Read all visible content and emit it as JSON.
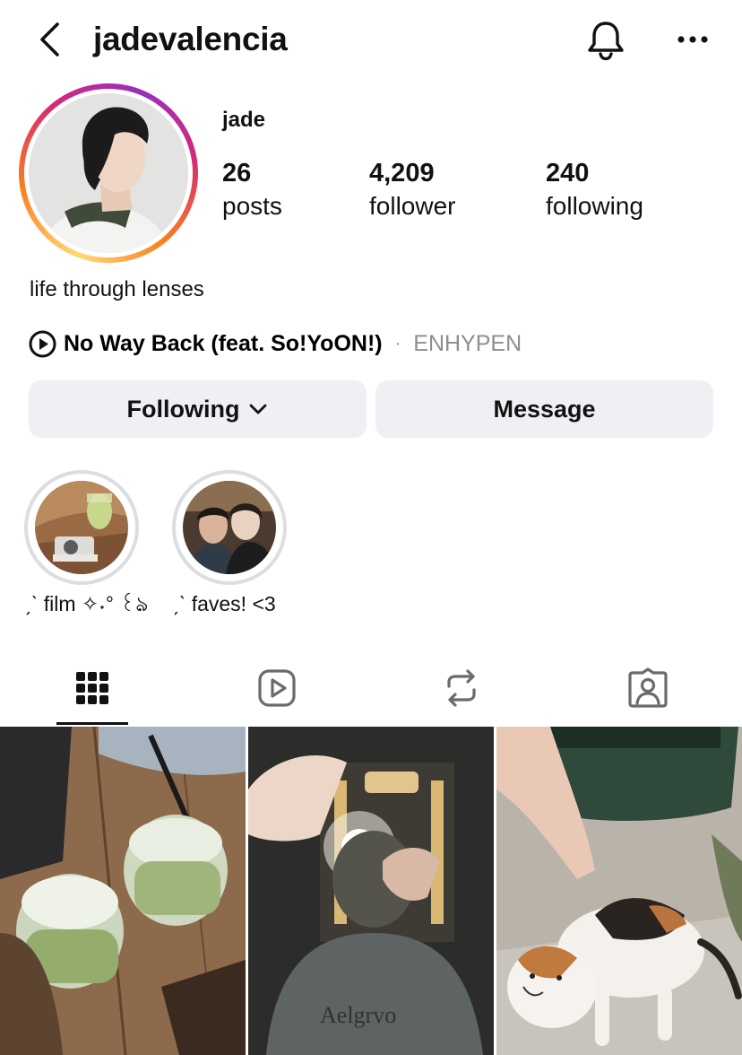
{
  "header": {
    "username": "jadevalencia",
    "back_icon": "chevron-left-icon",
    "bell_icon": "bell-icon",
    "more_icon": "more-horizontal-icon"
  },
  "profile": {
    "display_name": "jade",
    "stats": [
      {
        "value": "26",
        "label": "posts"
      },
      {
        "value": "4,209",
        "label": "follower"
      },
      {
        "value": "240",
        "label": "following"
      }
    ],
    "bio": "life through lenses",
    "music": {
      "icon": "play-circle-icon",
      "title": "No Way Back (feat. So!YoON!)",
      "separator": "·",
      "artist": "ENHYPEN"
    }
  },
  "actions": {
    "following_label": "Following",
    "message_label": "Message"
  },
  "highlights": [
    {
      "label": "ˏˋ film ✧˖° ꒰ঌ"
    },
    {
      "label": "ˏˋ faves! <3"
    }
  ],
  "tabs": [
    {
      "icon": "grid-icon",
      "active": true
    },
    {
      "icon": "reels-icon",
      "active": false
    },
    {
      "icon": "reposts-icon",
      "active": false
    },
    {
      "icon": "tagged-icon",
      "active": false
    }
  ],
  "colors": {
    "button_bg": "#eef0f3",
    "muted_text": "#8e8e8e",
    "highlight_ring": "#dbdde1"
  }
}
